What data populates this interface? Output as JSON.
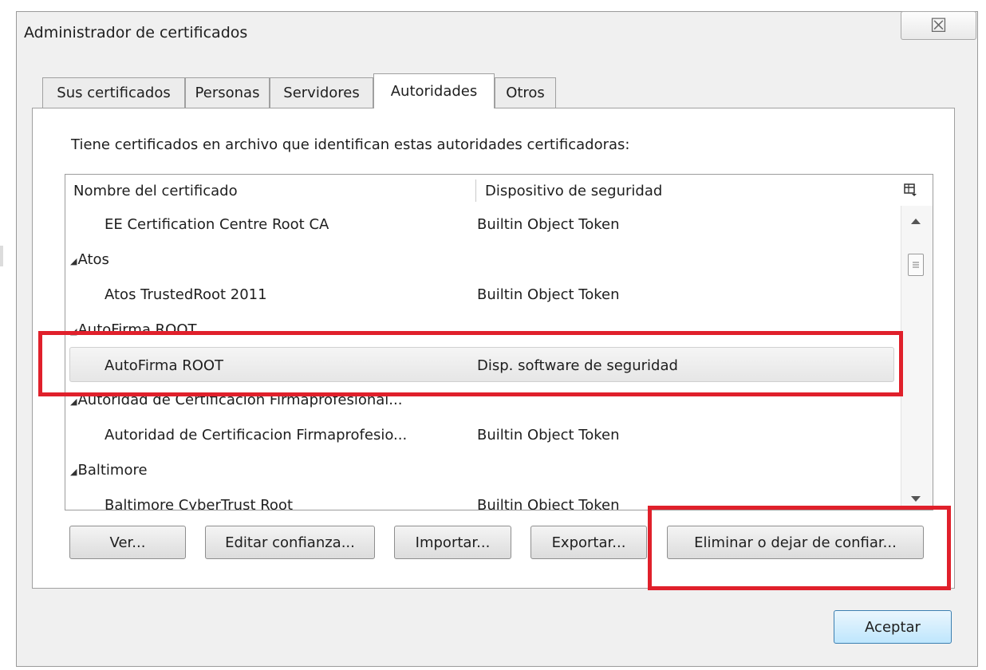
{
  "window": {
    "title": "Administrador de certificados",
    "close_glyph": "☒"
  },
  "tabs": [
    {
      "label": "Sus certificados"
    },
    {
      "label": "Personas"
    },
    {
      "label": "Servidores"
    },
    {
      "label": "Autoridades",
      "active": true
    },
    {
      "label": "Otros"
    }
  ],
  "panel": {
    "intro": "Tiene certificados en archivo que identifican estas autoridades certificadoras:"
  },
  "tree": {
    "columns": [
      "Nombre del certificado",
      "Dispositivo de seguridad"
    ],
    "column_picker_icon": "column-picker-icon",
    "rows": [
      {
        "name": "EE Certification Centre Root CA",
        "device": "Builtin Object Token"
      },
      {
        "name": "Atos",
        "device": ""
      },
      {
        "name": "Atos TrustedRoot 2011",
        "device": "Builtin Object Token"
      },
      {
        "name": "AutoFirma ROOT",
        "device": ""
      },
      {
        "name": "AutoFirma ROOT",
        "device": "Disp. software de seguridad"
      },
      {
        "name": "Autoridad de Certificacion Firmaprofesional...",
        "device": ""
      },
      {
        "name": "Autoridad de Certificacion Firmaprofesio...",
        "device": "Builtin Object Token"
      },
      {
        "name": "Baltimore",
        "device": ""
      },
      {
        "name": "Baltimore CyberTrust Root",
        "device": "Builtin Object Token"
      }
    ]
  },
  "buttons": {
    "view": "Ver...",
    "edit_trust": "Editar confianza...",
    "import": "Importar...",
    "export": "Exportar...",
    "delete": "Eliminar o dejar de confiar...",
    "ok": "Aceptar"
  },
  "colors": {
    "highlight": "#e0202b",
    "accent": "#3c7fb1"
  }
}
